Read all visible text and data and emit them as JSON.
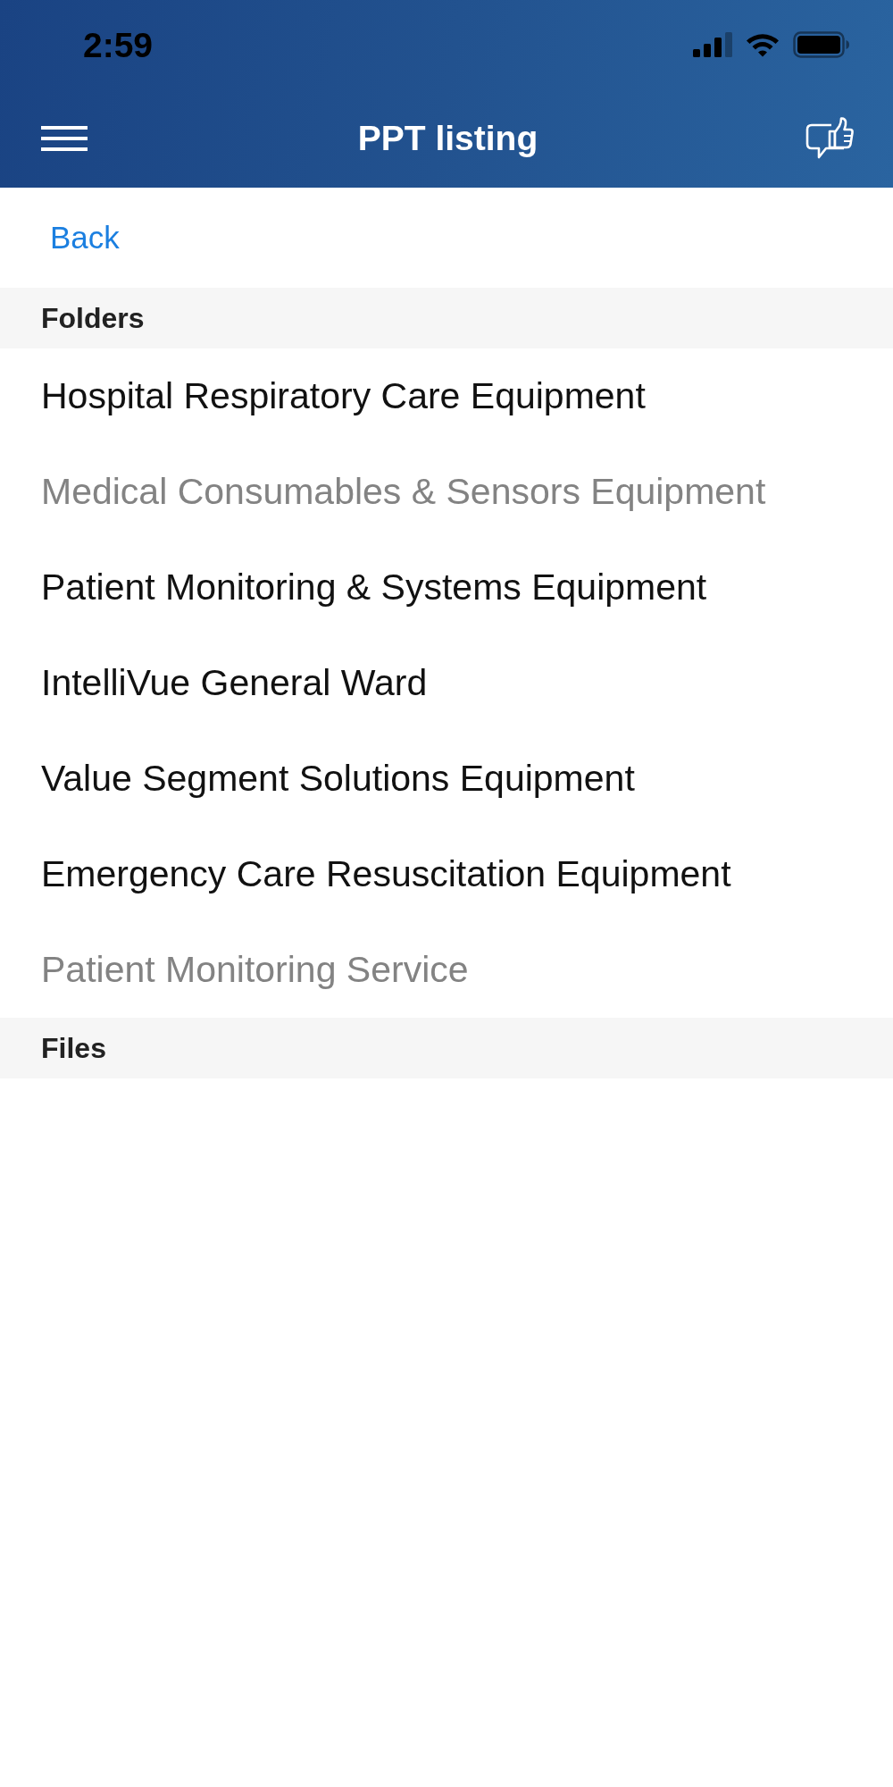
{
  "status_bar": {
    "time": "2:59"
  },
  "nav_bar": {
    "title": "PPT listing"
  },
  "back_link": {
    "label": "Back"
  },
  "sections": [
    {
      "title": "Folders",
      "items": [
        {
          "label": "Hospital Respiratory Care Equipment",
          "disabled": false
        },
        {
          "label": "Medical Consumables & Sensors Equipment",
          "disabled": true
        },
        {
          "label": "Patient Monitoring & Systems Equipment",
          "disabled": false
        },
        {
          "label": "IntelliVue General Ward",
          "disabled": false
        },
        {
          "label": "Value Segment Solutions Equipment",
          "disabled": false
        },
        {
          "label": "Emergency Care Resuscitation Equipment",
          "disabled": false
        },
        {
          "label": "Patient Monitoring Service",
          "disabled": true
        }
      ]
    },
    {
      "title": "Files"
    }
  ]
}
